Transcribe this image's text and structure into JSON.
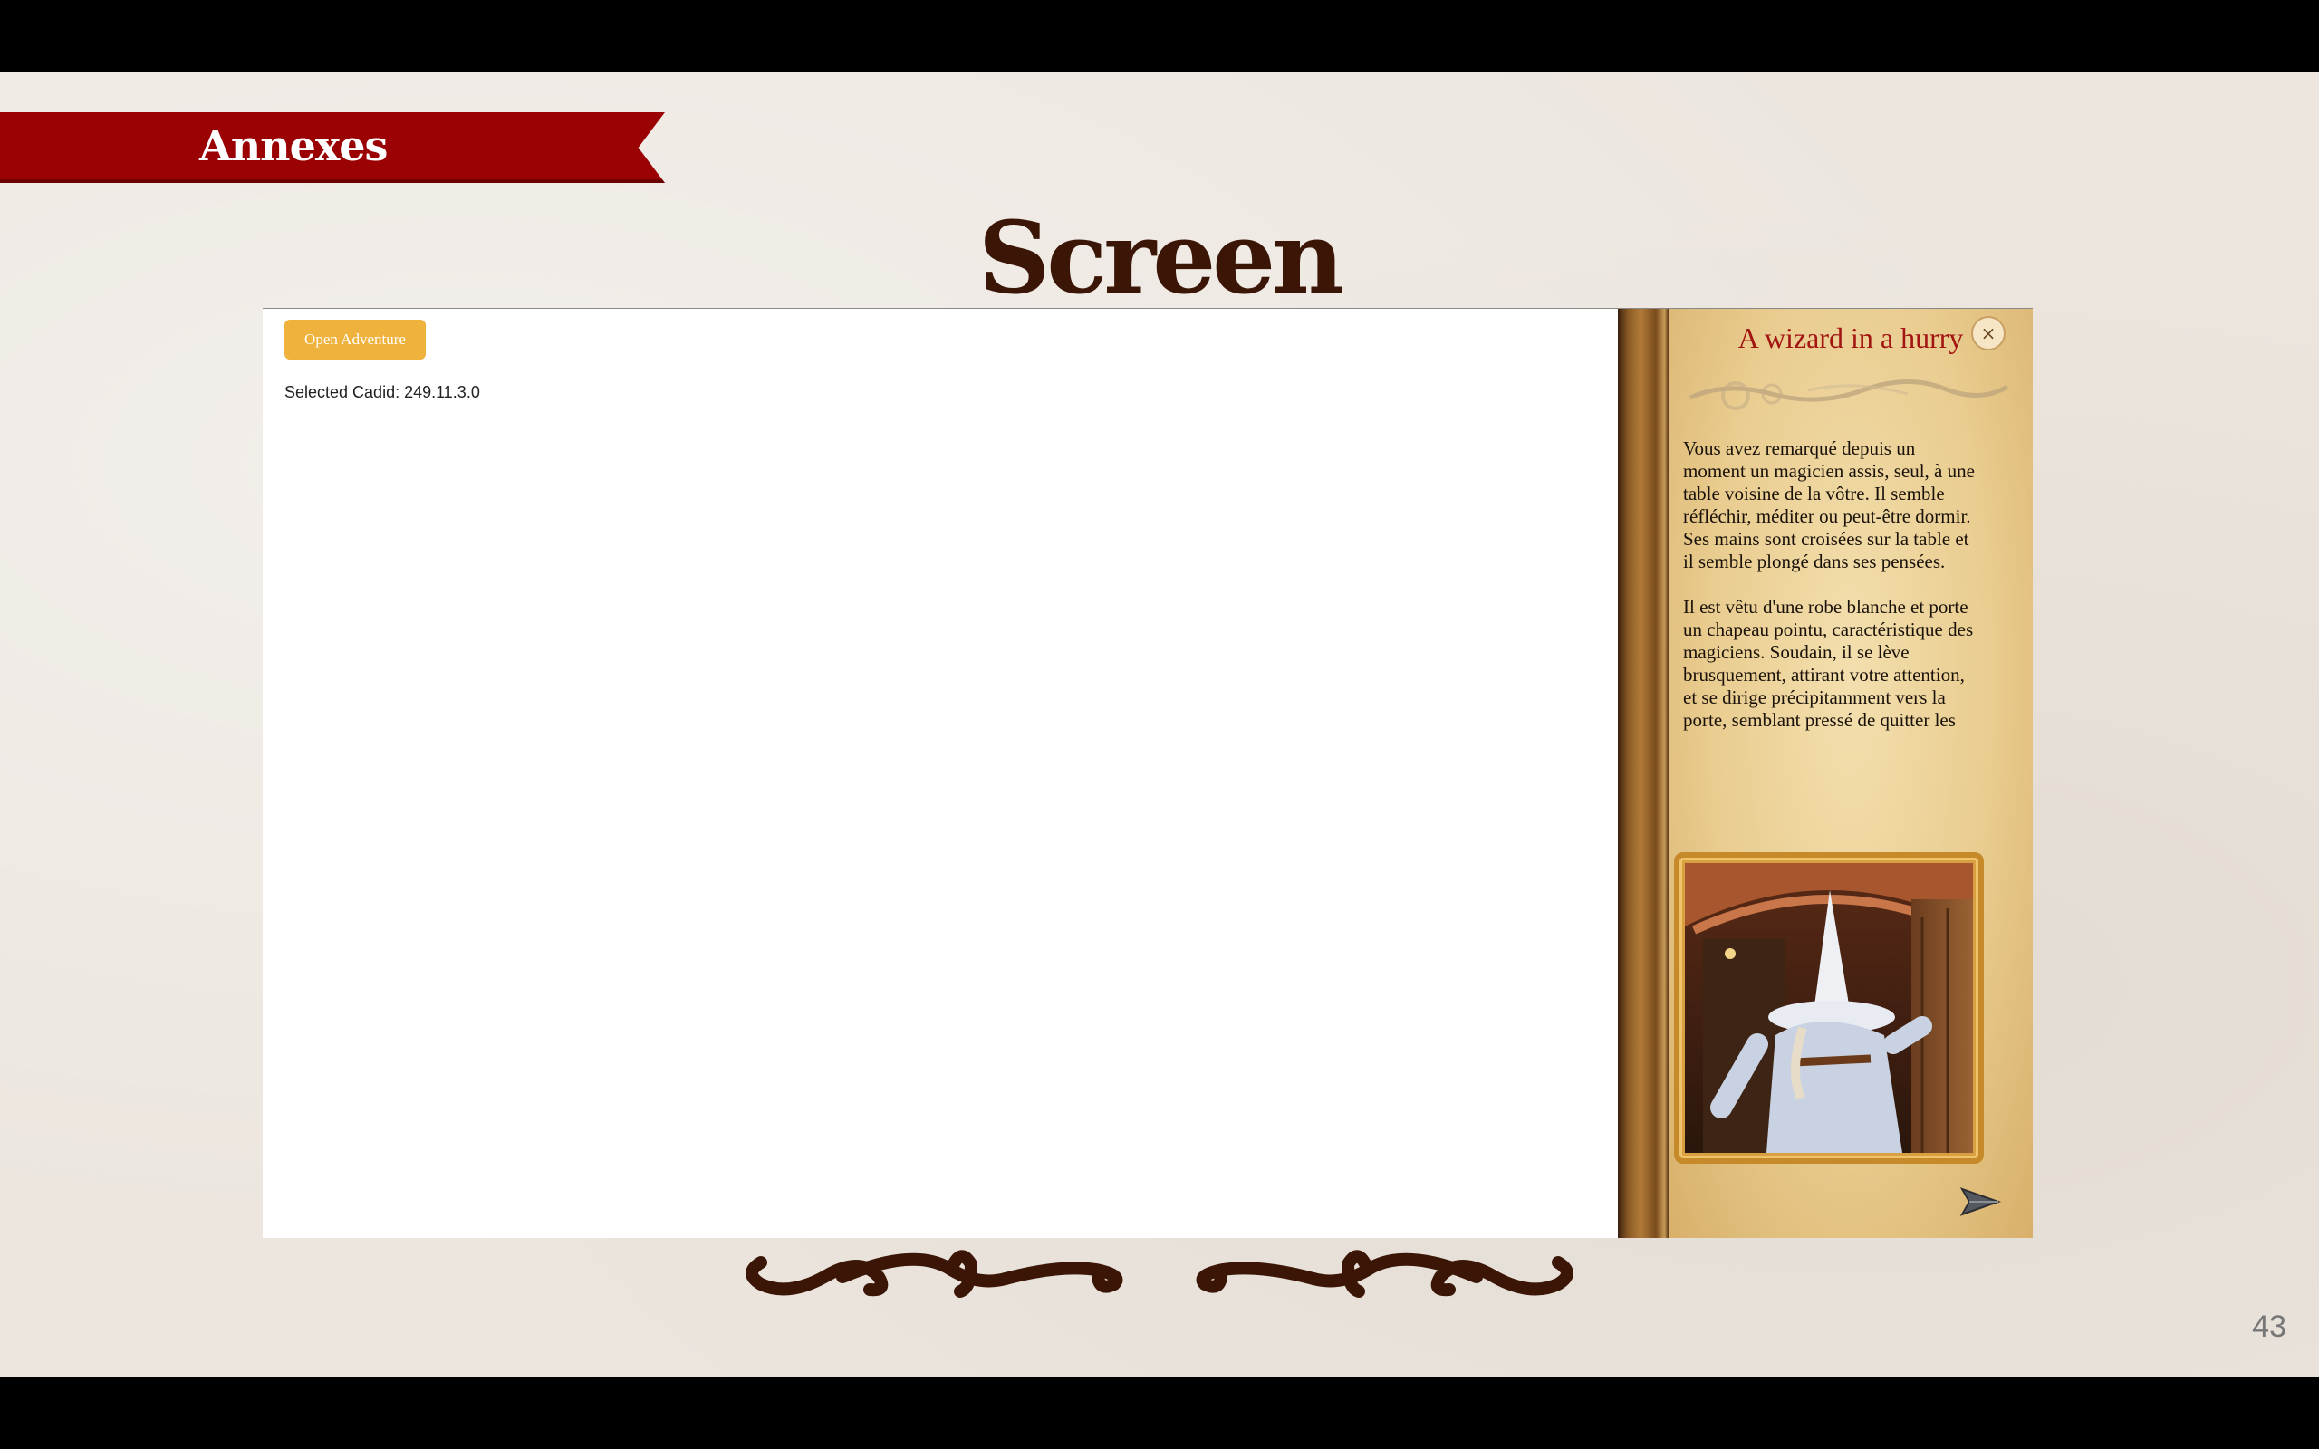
{
  "slide": {
    "section": "Annexes",
    "title": "Screen",
    "page_number": "43"
  },
  "app": {
    "open_button_label": "Open Adventure",
    "selected_cadid": "Selected Cadid: 249.11.3.0"
  },
  "book": {
    "title": "A wizard in a hurry",
    "close_glyph": "×",
    "paragraphs": [
      "Vous avez remarqué depuis un moment un magicien assis, seul, à une table voisine de la vôtre. Il semble réfléchir, méditer ou peut-être dormir. Ses mains sont croisées sur la table et il semble plongé dans ses pensées.",
      "Il est vêtu d'une robe blanche et porte un chapeau pointu, caractéristique des magiciens. Soudain, il se lève brusquement, attirant votre attention, et se dirige précipitamment vers la porte, semblant pressé de quitter les"
    ],
    "image_icon": "wizard-leaving-through-door",
    "next_icon": "paper-plane-arrow"
  },
  "colors": {
    "banner": "#9b0203",
    "title": "#3b1606",
    "button": "#efb23c",
    "book_title": "#a31512"
  }
}
